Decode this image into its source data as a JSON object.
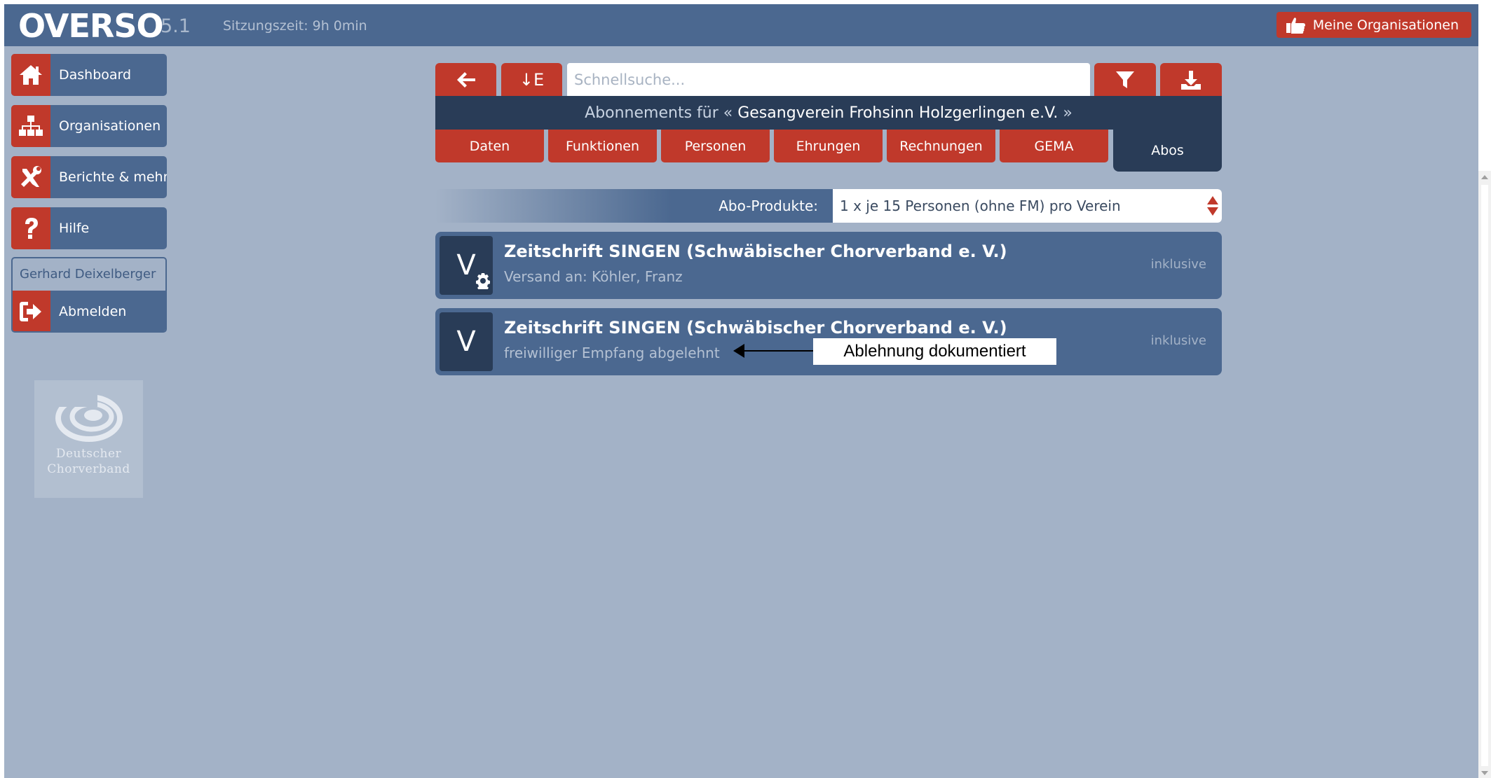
{
  "header": {
    "app_name": "OVERSO",
    "version": "5.1",
    "session": "Sitzungszeit: 9h 0min",
    "org_button_label": "Meine Organisationen"
  },
  "sidebar": {
    "items": [
      {
        "label": "Dashboard",
        "icon": "home-icon"
      },
      {
        "label": "Organisationen",
        "icon": "sitemap-icon"
      },
      {
        "label": "Berichte & mehr",
        "icon": "tools-icon"
      },
      {
        "label": "Hilfe",
        "icon": "question-icon"
      }
    ],
    "user_name": "Gerhard Deixelberger",
    "logout_label": "Abmelden",
    "logo_line1": "Deutscher",
    "logo_line2": "Chorverband"
  },
  "toolbar": {
    "sort_label": "↓E",
    "search_placeholder": "Schnellsuche..."
  },
  "title": {
    "prefix": "Abonnements für «",
    "org": "Gesangverein Frohsinn Holzgerlingen e.V.",
    "suffix": "»"
  },
  "tabs": [
    {
      "label": "Daten"
    },
    {
      "label": "Funktionen"
    },
    {
      "label": "Personen"
    },
    {
      "label": "Ehrungen"
    },
    {
      "label": "Rechnungen"
    },
    {
      "label": "GEMA"
    },
    {
      "label": "Abos",
      "active": true
    }
  ],
  "abo_products": {
    "label": "Abo-Produkte:",
    "selected": "1 x je 15 Personen (ohne FM) pro Verein"
  },
  "subscriptions": [
    {
      "badge": "V",
      "title": "Zeitschrift SINGEN (Schwäbischer Chorverband e. V.)",
      "subtitle": "Versand an: Köhler, Franz",
      "status": "inklusive"
    },
    {
      "badge": "V",
      "title": "Zeitschrift SINGEN (Schwäbischer Chorverband e. V.)",
      "subtitle": "freiwilliger Empfang abgelehnt",
      "status": "inklusive"
    }
  ],
  "annotation": {
    "text": "Ablehnung dokumentiert"
  },
  "colors": {
    "primary": "#4b6890",
    "dark": "#293c57",
    "accent": "#c0392b",
    "background": "#a3b2c7"
  }
}
